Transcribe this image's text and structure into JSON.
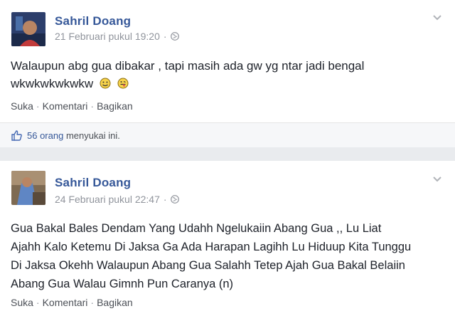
{
  "posts": [
    {
      "author": "Sahril Doang",
      "timestamp": "21 Februari pukul 19:20",
      "separator": "·",
      "text_line1": "Walaupun abg gua dibakar , tapi masih ada gw yg ntar jadi bengal",
      "text_line2": "wkwkwkwkwkw",
      "actions": {
        "like": "Suka",
        "comment": "Komentari",
        "share": "Bagikan"
      },
      "likes_count": "56 orang",
      "likes_suffix": "menyukai ini."
    },
    {
      "author": "Sahril Doang",
      "timestamp": "24 Februari pukul 22:47",
      "separator": "·",
      "text_lines": [
        "Gua Bakal Bales Dendam Yang Udahh Ngelukaiin Abang Gua ,, Lu Liat",
        "Ajahh Kalo Ketemu Di Jaksa Ga Ada Harapan Lagihh Lu Hiduup Kita Tunggu",
        "Di Jaksa Okehh Walaupun Abang Gua Salahh Tetep Ajah Gua Bakal Belaiin",
        "Abang Gua Walau Gimnh Pun Caranya (n)"
      ],
      "actions": {
        "like": "Suka",
        "comment": "Komentari",
        "share": "Bagikan"
      }
    }
  ],
  "icons": {
    "audience": "globe-icon",
    "menu": "chevron-down-icon",
    "like": "thumbs-up-icon",
    "emoji1": "smiley-emoji-icon",
    "emoji2": "tongue-emoji-icon"
  },
  "colors": {
    "link": "#365899",
    "meta": "#90949c",
    "background": "#e9ebee"
  }
}
